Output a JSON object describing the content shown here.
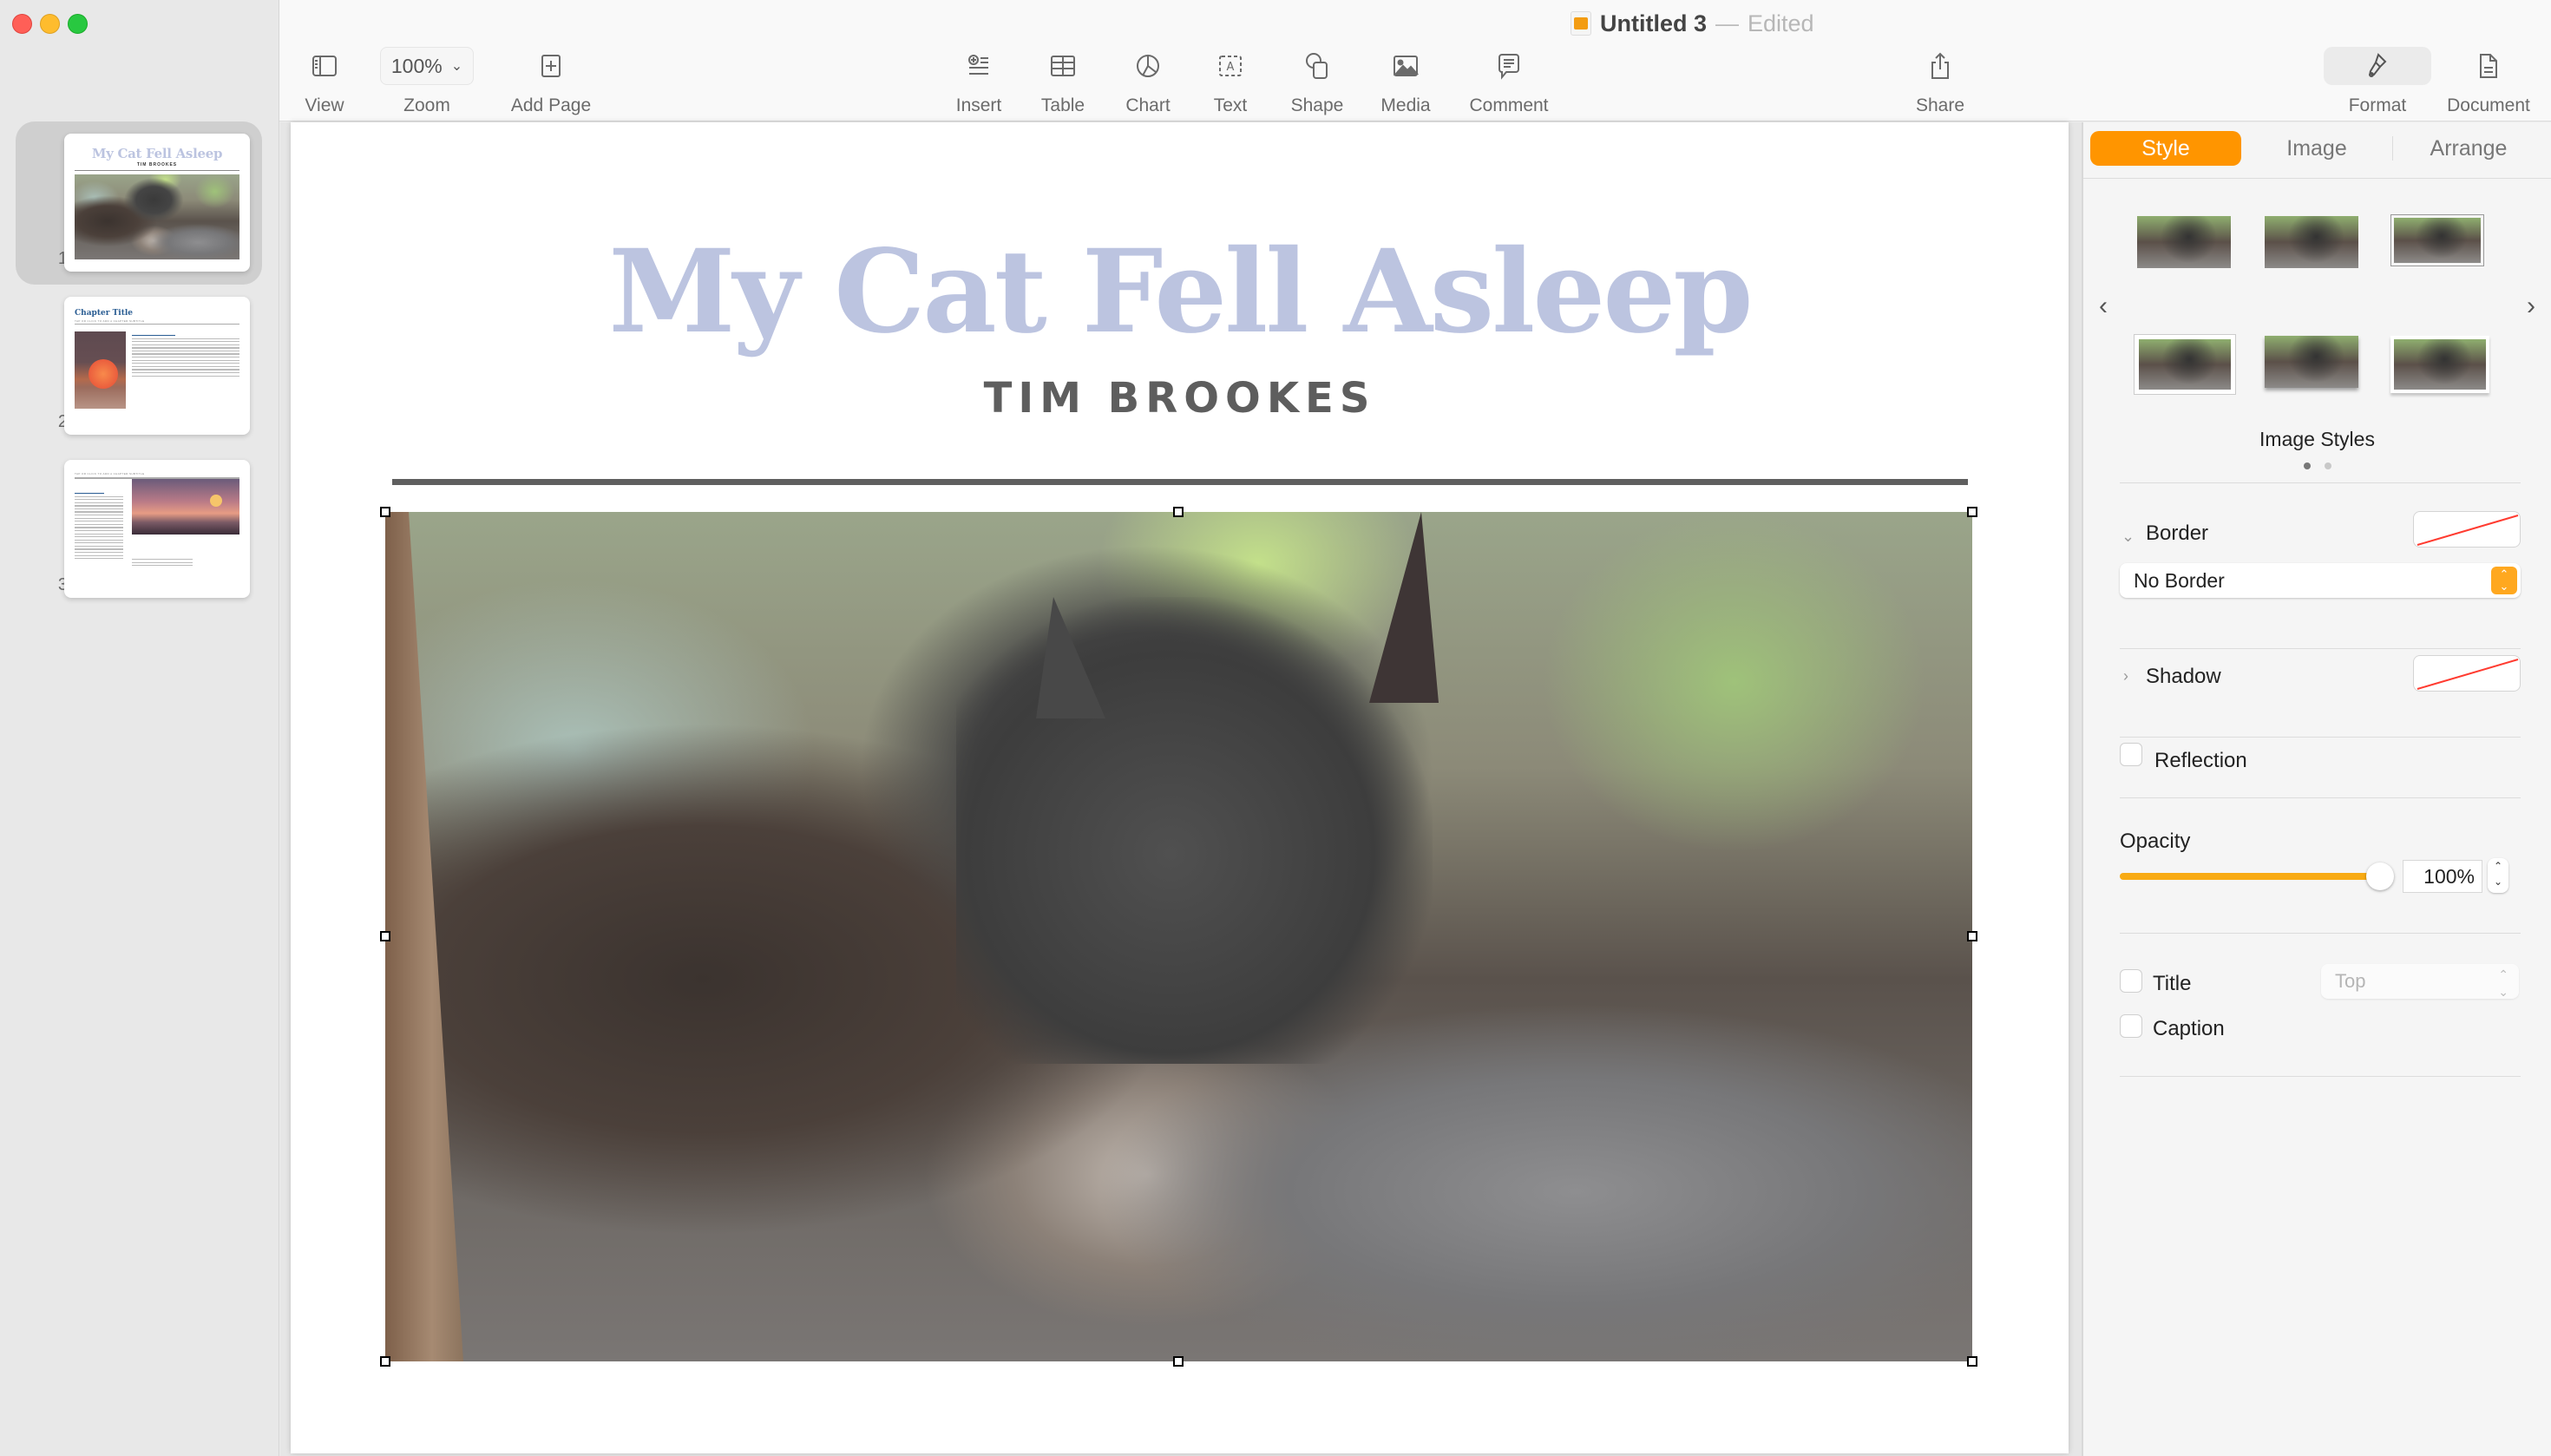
{
  "window": {
    "doc_name": "Untitled 3",
    "separator": "—",
    "status": "Edited"
  },
  "toolbar": {
    "left": [
      {
        "id": "view",
        "label": "View",
        "icon": "sidebar-icon"
      },
      {
        "id": "zoom",
        "label": "Zoom",
        "value": "100%",
        "icon": "chevron-down-icon"
      },
      {
        "id": "add-page",
        "label": "Add Page",
        "icon": "plus-square-icon"
      }
    ],
    "center": [
      {
        "id": "insert",
        "label": "Insert",
        "icon": "insert-list-icon"
      },
      {
        "id": "table",
        "label": "Table",
        "icon": "table-icon"
      },
      {
        "id": "chart",
        "label": "Chart",
        "icon": "pie-chart-icon"
      },
      {
        "id": "text",
        "label": "Text",
        "icon": "text-box-icon"
      },
      {
        "id": "shape",
        "label": "Shape",
        "icon": "shape-icon"
      },
      {
        "id": "media",
        "label": "Media",
        "icon": "photo-icon"
      },
      {
        "id": "comment",
        "label": "Comment",
        "icon": "comment-icon"
      }
    ],
    "share": {
      "label": "Share",
      "icon": "share-icon"
    },
    "right": [
      {
        "id": "format",
        "label": "Format",
        "icon": "paintbrush-icon",
        "active": true
      },
      {
        "id": "document",
        "label": "Document",
        "icon": "document-icon"
      }
    ]
  },
  "sidebar": {
    "pages": [
      {
        "number": "1",
        "selected": true,
        "title": "My Cat Fell Asleep",
        "author": "TIM BROOKES"
      },
      {
        "number": "2",
        "selected": false,
        "title": "Chapter Title",
        "subtitle": "TAP OR CLICK TO ADD A CHAPTER SUBTITLE",
        "heading": "Tap or click to add a heading"
      },
      {
        "number": "3",
        "selected": false,
        "subtitle": "TAP OR CLICK TO ADD A CHAPTER SUBTITLE",
        "heading": "Add a heading"
      }
    ]
  },
  "page": {
    "title": "My Cat Fell Asleep",
    "author": "TIM BROOKES",
    "title_color": "#bcc4e0",
    "rule_color": "#5f5f5f",
    "image_selected": true
  },
  "inspector": {
    "tabs": [
      {
        "label": "Style",
        "active": true
      },
      {
        "label": "Image",
        "active": false
      },
      {
        "label": "Arrange",
        "active": false
      }
    ],
    "accent": "#ff9500",
    "image_styles": {
      "label": "Image Styles",
      "count": 6,
      "page_index": 1,
      "page_count": 2
    },
    "border": {
      "label": "Border",
      "expanded": true,
      "value": "No Border"
    },
    "shadow": {
      "label": "Shadow",
      "expanded": false
    },
    "reflection": {
      "label": "Reflection",
      "checked": false
    },
    "opacity": {
      "label": "Opacity",
      "value": "100%",
      "fraction": 1.0
    },
    "title": {
      "label": "Title",
      "checked": false,
      "position": "Top"
    },
    "caption": {
      "label": "Caption",
      "checked": false
    }
  }
}
